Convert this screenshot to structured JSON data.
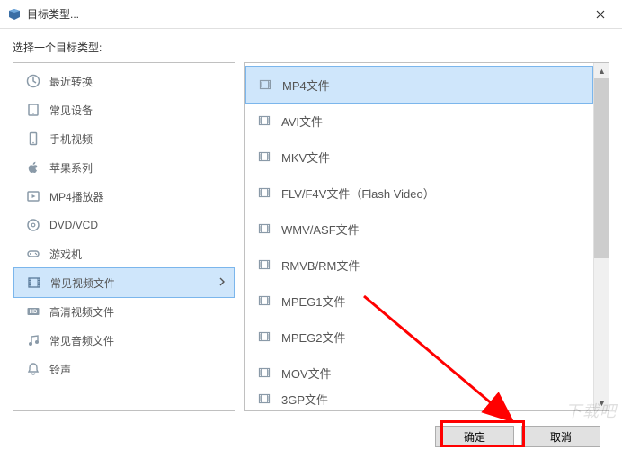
{
  "titlebar": {
    "title": "目标类型..."
  },
  "prompt": "选择一个目标类型:",
  "categories": {
    "items": [
      {
        "label": "最近转换",
        "icon": "clock"
      },
      {
        "label": "常见设备",
        "icon": "tablet"
      },
      {
        "label": "手机视频",
        "icon": "phone"
      },
      {
        "label": "苹果系列",
        "icon": "apple"
      },
      {
        "label": "MP4播放器",
        "icon": "player"
      },
      {
        "label": "DVD/VCD",
        "icon": "disc"
      },
      {
        "label": "游戏机",
        "icon": "gamepad"
      },
      {
        "label": "常见视频文件",
        "icon": "film",
        "selected": true
      },
      {
        "label": "高清视频文件",
        "icon": "hd"
      },
      {
        "label": "常见音频文件",
        "icon": "music"
      },
      {
        "label": "铃声",
        "icon": "bell"
      }
    ]
  },
  "formats": {
    "items": [
      {
        "label": "MP4文件",
        "selected": true
      },
      {
        "label": "AVI文件"
      },
      {
        "label": "MKV文件"
      },
      {
        "label": "FLV/F4V文件（Flash Video）"
      },
      {
        "label": "WMV/ASF文件"
      },
      {
        "label": "RMVB/RM文件"
      },
      {
        "label": "MPEG1文件"
      },
      {
        "label": "MPEG2文件"
      },
      {
        "label": "MOV文件"
      },
      {
        "label": "3GP文件",
        "clipped": true
      }
    ]
  },
  "buttons": {
    "ok": "确定",
    "cancel": "取消"
  },
  "watermark": "下载吧"
}
